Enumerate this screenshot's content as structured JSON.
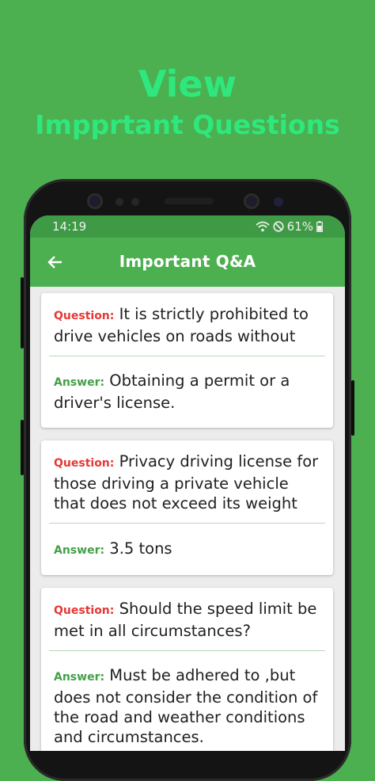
{
  "promo": {
    "line1": "View",
    "line2": "Impprtant Questions"
  },
  "status_bar": {
    "time": "14:19",
    "battery": "61%",
    "icons": [
      "wifi-icon",
      "do-not-disturb-icon",
      "battery-icon"
    ]
  },
  "app_bar": {
    "back_icon": "arrow-back-icon",
    "title": "Important Q&A"
  },
  "qa_items": [
    {
      "question_label": "Question:",
      "question": "It is strictly prohibited to drive vehicles on roads without",
      "answer_label": "Answer:",
      "answer": "Obtaining a permit or a driver's license."
    },
    {
      "question_label": "Question:",
      "question": "Privacy driving license for those driving a private vehicle that does not exceed its weight",
      "answer_label": "Answer:",
      "answer": "3.5 tons"
    },
    {
      "question_label": "Question:",
      "question": "Should the speed limit be met in all circumstances?",
      "answer_label": "Answer:",
      "answer": "Must be adhered to ,but does not consider the condition of the road and weather conditions and circumstances."
    }
  ],
  "colors": {
    "background": "#4caf50",
    "promo_text": "#2ee87e",
    "question_label": "#e53935",
    "answer_label": "#43a047"
  }
}
